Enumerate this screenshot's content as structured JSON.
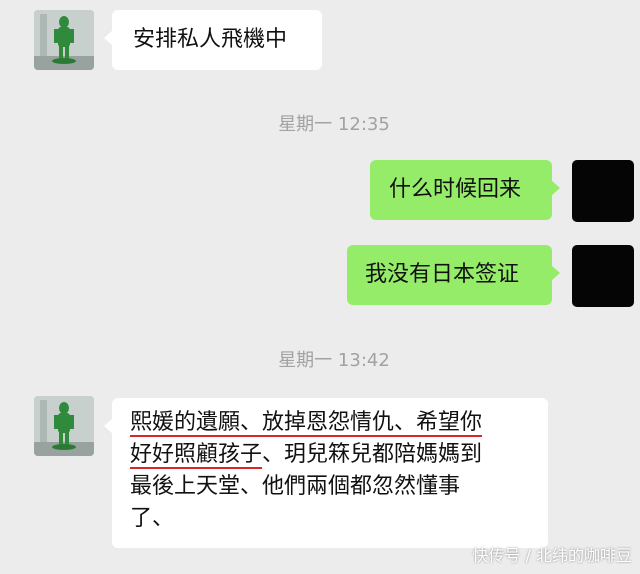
{
  "messages": [
    {
      "id": "m1",
      "text": "安排私人飛機中"
    },
    {
      "id": "t1",
      "text": "星期一 12:35"
    },
    {
      "id": "m2",
      "text": "什么时候回来"
    },
    {
      "id": "m3",
      "text": "我没有日本签证"
    },
    {
      "id": "t2",
      "text": "星期一 13:42"
    }
  ],
  "long_message": {
    "segments": [
      "熙媛的遺願、放掉恩怨情仇、希望你",
      "好好照顧孩子",
      "、玥兒箖兒都陪媽媽到",
      "最後上天堂、他們兩個都忽然懂事",
      "了、"
    ]
  },
  "colors": {
    "background": "#ececec",
    "incoming_bubble": "#ffffff",
    "outgoing_bubble": "#95ec69",
    "timestamp": "#a2a2a2",
    "annotation_underline": "#d8262d"
  },
  "watermark": "快传号 / 北纬的咖啡豆",
  "icons": {
    "left_avatar": "green-figure-avatar",
    "right_avatar": "black-avatar"
  }
}
